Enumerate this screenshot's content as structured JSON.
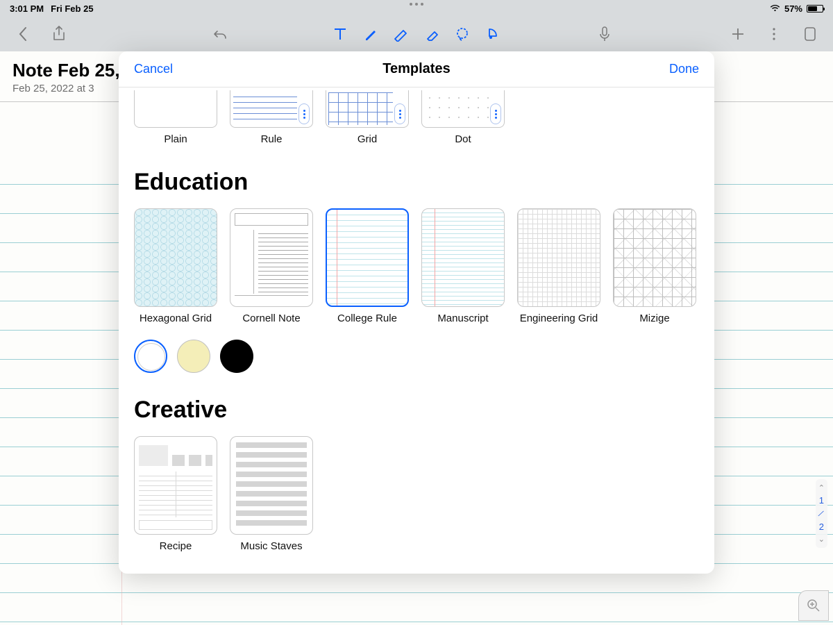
{
  "status": {
    "time": "3:01 PM",
    "date": "Fri Feb 25",
    "battery": "57%"
  },
  "note": {
    "title": "Note Feb 25,",
    "subtitle": "Feb 25, 2022 at 3"
  },
  "modal": {
    "title": "Templates",
    "cancel": "Cancel",
    "done": "Done",
    "basic": [
      {
        "label": "Plain"
      },
      {
        "label": "Rule"
      },
      {
        "label": "Grid"
      },
      {
        "label": "Dot"
      }
    ],
    "sections": {
      "education": {
        "title": "Education",
        "items": [
          {
            "label": "Hexagonal Grid"
          },
          {
            "label": "Cornell Note"
          },
          {
            "label": "College Rule",
            "selected": true
          },
          {
            "label": "Manuscript"
          },
          {
            "label": "Engineering Grid"
          },
          {
            "label": "Mizige"
          }
        ],
        "colors": [
          {
            "name": "white",
            "hex": "#ffffff",
            "selected": true
          },
          {
            "name": "cream",
            "hex": "#f4eeb8"
          },
          {
            "name": "black",
            "hex": "#000000"
          }
        ]
      },
      "creative": {
        "title": "Creative",
        "items": [
          {
            "label": "Recipe"
          },
          {
            "label": "Music Staves"
          }
        ]
      }
    }
  },
  "pager": {
    "current": "1",
    "total": "2"
  }
}
